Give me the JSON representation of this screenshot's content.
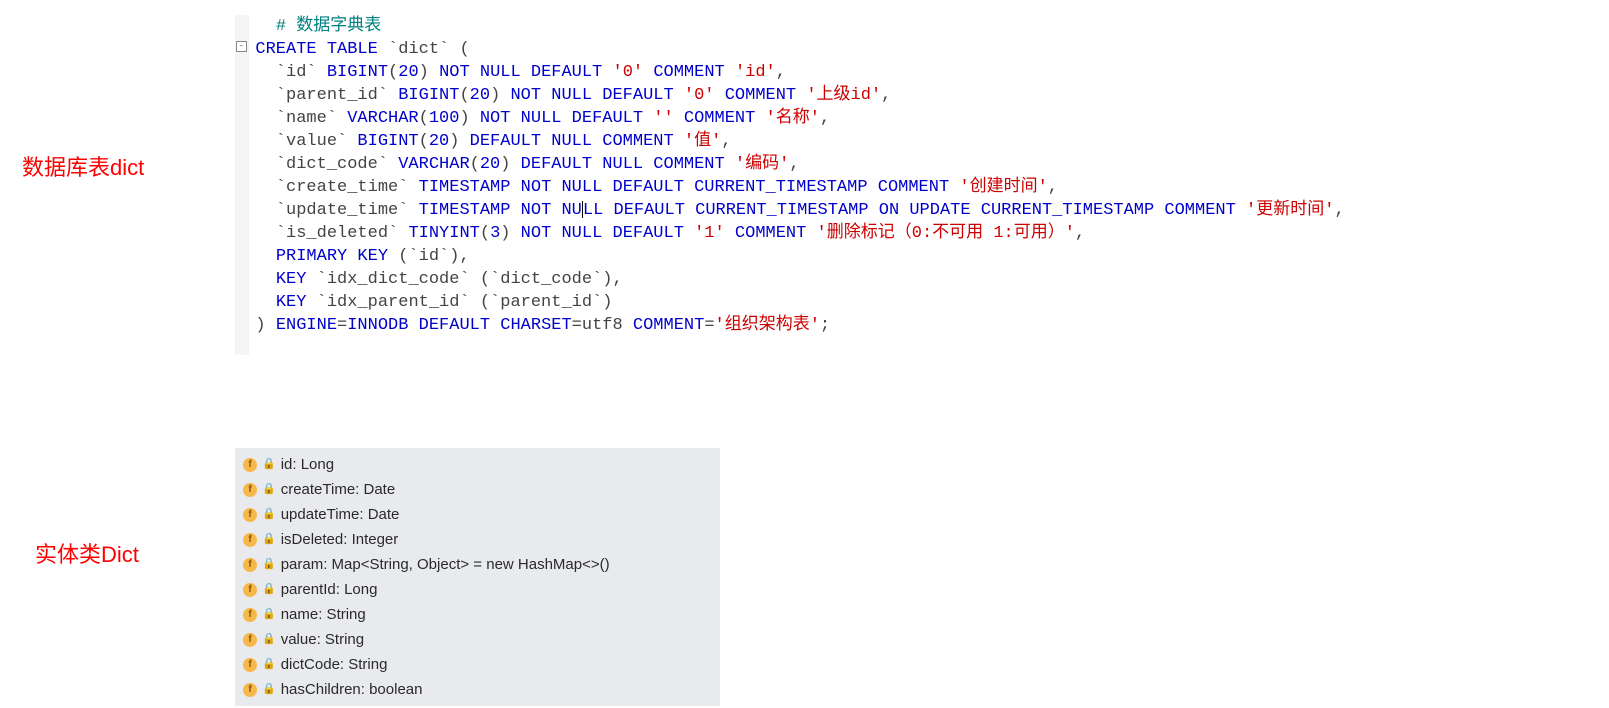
{
  "labels": {
    "db_table": "数据库表dict",
    "entity": "实体类Dict"
  },
  "sql": {
    "comment": "# 数据字典表",
    "fold_symbol": "-",
    "tokens": [
      {
        "type": "raw",
        "html": "<span class='gray'>    </span><span class='comment'># 数据字典表</span>"
      },
      {
        "type": "raw",
        "html": "<span class='gray'>  </span><span class='keyword'>CREATE TABLE</span><span class='normal'> `dict` (</span>"
      },
      {
        "type": "raw",
        "html": "<span class='normal'>    `id` </span><span class='datatype'>BIGINT</span><span class='normal'>(</span><span class='datatype'>20</span><span class='normal'>) </span><span class='keyword'>NOT NULL DEFAULT</span><span class='normal'> </span><span class='str'>'0'</span><span class='normal'> </span><span class='keyword'>COMMENT</span><span class='normal'> </span><span class='str'>'id'</span><span class='normal'>,</span>"
      },
      {
        "type": "raw",
        "html": "<span class='normal'>    `parent_id` </span><span class='datatype'>BIGINT</span><span class='normal'>(</span><span class='datatype'>20</span><span class='normal'>) </span><span class='keyword'>NOT NULL DEFAULT</span><span class='normal'> </span><span class='str'>'0'</span><span class='normal'> </span><span class='keyword'>COMMENT</span><span class='normal'> </span><span class='str'>'上级id'</span><span class='normal'>,</span>"
      },
      {
        "type": "raw",
        "html": "<span class='normal'>    `name` </span><span class='datatype'>VARCHAR</span><span class='normal'>(</span><span class='datatype'>100</span><span class='normal'>) </span><span class='keyword'>NOT NULL DEFAULT</span><span class='normal'> </span><span class='str'>''</span><span class='normal'> </span><span class='keyword'>COMMENT</span><span class='normal'> </span><span class='str'>'名称'</span><span class='normal'>,</span>"
      },
      {
        "type": "raw",
        "html": "<span class='normal'>    `value` </span><span class='datatype'>BIGINT</span><span class='normal'>(</span><span class='datatype'>20</span><span class='normal'>) </span><span class='keyword'>DEFAULT NULL COMMENT</span><span class='normal'> </span><span class='str'>'值'</span><span class='normal'>,</span>"
      },
      {
        "type": "raw",
        "html": "<span class='normal'>    `dict_code` </span><span class='datatype'>VARCHAR</span><span class='normal'>(</span><span class='datatype'>20</span><span class='normal'>) </span><span class='keyword'>DEFAULT NULL COMMENT</span><span class='normal'> </span><span class='str'>'编码'</span><span class='normal'>,</span>"
      },
      {
        "type": "raw",
        "html": "<span class='normal'>    `create_time` </span><span class='datatype'>TIMESTAMP</span><span class='normal'> </span><span class='keyword'>NOT NULL DEFAULT</span><span class='normal'> </span><span class='keyword'>CURRENT_TIMESTAMP</span><span class='normal'> </span><span class='keyword'>COMMENT</span><span class='normal'> </span><span class='str'>'创建时间'</span><span class='normal'>,</span>"
      },
      {
        "type": "raw",
        "html": "<span class='normal'>    `update_time` </span><span class='datatype'>TIMESTAMP</span><span class='normal'> </span><span class='keyword'>NOT NU<span class='cursor-mark'></span>LL DEFAULT</span><span class='normal'> </span><span class='keyword'>CURRENT_TIMESTAMP ON UPDATE CURRENT_TIMESTAMP COMMENT</span><span class='normal'> </span><span class='str'>'更新时间'</span><span class='normal'>,</span>"
      },
      {
        "type": "raw",
        "html": "<span class='normal'>    `is_deleted` </span><span class='datatype'>TINYINT</span><span class='normal'>(</span><span class='datatype'>3</span><span class='normal'>) </span><span class='keyword'>NOT NULL DEFAULT</span><span class='normal'> </span><span class='str'>'1'</span><span class='normal'> </span><span class='keyword'>COMMENT</span><span class='normal'> </span><span class='str'>'删除标记（0:不可用 1:可用）'</span><span class='normal'>,</span>"
      },
      {
        "type": "raw",
        "html": "<span class='normal'>    </span><span class='keyword'>PRIMARY KEY</span><span class='normal'> (`id`),</span>"
      },
      {
        "type": "raw",
        "html": "<span class='normal'>    </span><span class='keyword'>KEY</span><span class='normal'> `idx_dict_code` (`dict_code`),</span>"
      },
      {
        "type": "raw",
        "html": "<span class='normal'>    </span><span class='keyword'>KEY</span><span class='normal'> `idx_parent_id` (`parent_id`)</span>"
      },
      {
        "type": "raw",
        "html": "<span class='normal'>  ) </span><span class='keyword'>ENGINE</span><span class='normal'>=</span><span class='keyword'>INNODB DEFAULT CHARSET</span><span class='normal'>=utf8 </span><span class='keyword'>COMMENT</span><span class='normal'>=</span><span class='str'>'组织架构表'</span><span class='normal'>;</span>"
      }
    ]
  },
  "entity_fields": [
    {
      "icon": "f",
      "lock": true,
      "text": "id: Long"
    },
    {
      "icon": "f",
      "lock": true,
      "text": "createTime: Date"
    },
    {
      "icon": "f",
      "lock": true,
      "text": "updateTime: Date"
    },
    {
      "icon": "f",
      "lock": true,
      "text": "isDeleted: Integer"
    },
    {
      "icon": "f",
      "lock": true,
      "text": "param: Map<String, Object> = new HashMap<>()"
    },
    {
      "icon": "f",
      "lock": true,
      "text": "parentId: Long"
    },
    {
      "icon": "f",
      "lock": true,
      "text": "name: String"
    },
    {
      "icon": "f",
      "lock": true,
      "text": "value: String"
    },
    {
      "icon": "f",
      "lock": true,
      "text": "dictCode: String"
    },
    {
      "icon": "f",
      "lock": true,
      "text": "hasChildren: boolean"
    }
  ]
}
